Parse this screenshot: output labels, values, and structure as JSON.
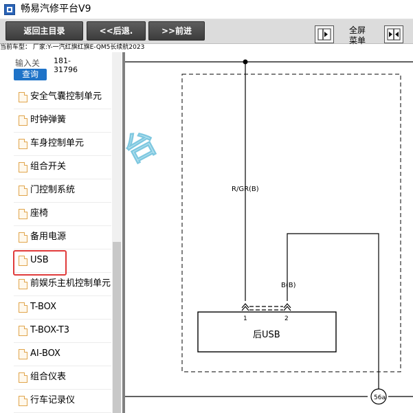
{
  "app": {
    "title": "畅易汽修平台V9"
  },
  "toolbar": {
    "home_label": "返回主目录",
    "back_label": "<<后退.",
    "forward_label": ">>前进",
    "fullscreen_line1": "全屏",
    "fullscreen_line2": "菜单"
  },
  "car_info": "当前车型： 厂家:Y-一汽红旗红旗E-QM5长续航2023",
  "sidebar": {
    "search_label": "输入关",
    "search_value_1": "181-",
    "search_value_2": "31796",
    "query_label": "查询",
    "items": [
      {
        "label": "安全气囊控制单元"
      },
      {
        "label": "时钟弹簧"
      },
      {
        "label": "车身控制单元"
      },
      {
        "label": "组合开关"
      },
      {
        "label": "门控制系统"
      },
      {
        "label": "座椅"
      },
      {
        "label": "备用电源"
      },
      {
        "label": "USB",
        "selected": true
      },
      {
        "label": "前娱乐主机控制单元"
      },
      {
        "label": "T-BOX"
      },
      {
        "label": "T-BOX-T3"
      },
      {
        "label": "AI-BOX"
      },
      {
        "label": "组合仪表"
      },
      {
        "label": "行车记录仪"
      }
    ]
  },
  "diagram": {
    "wire_1": "R/GR(B)",
    "wire_2": "B(B)",
    "pin_1": "1",
    "pin_2": "2",
    "component": "后USB",
    "ground": "56a",
    "watermark": "台"
  },
  "colors": {
    "toolbar_button": "#4a4a4a",
    "query_button": "#1e73c8",
    "selection_border": "#e03a3a",
    "doc_icon": "#e0a44a"
  }
}
